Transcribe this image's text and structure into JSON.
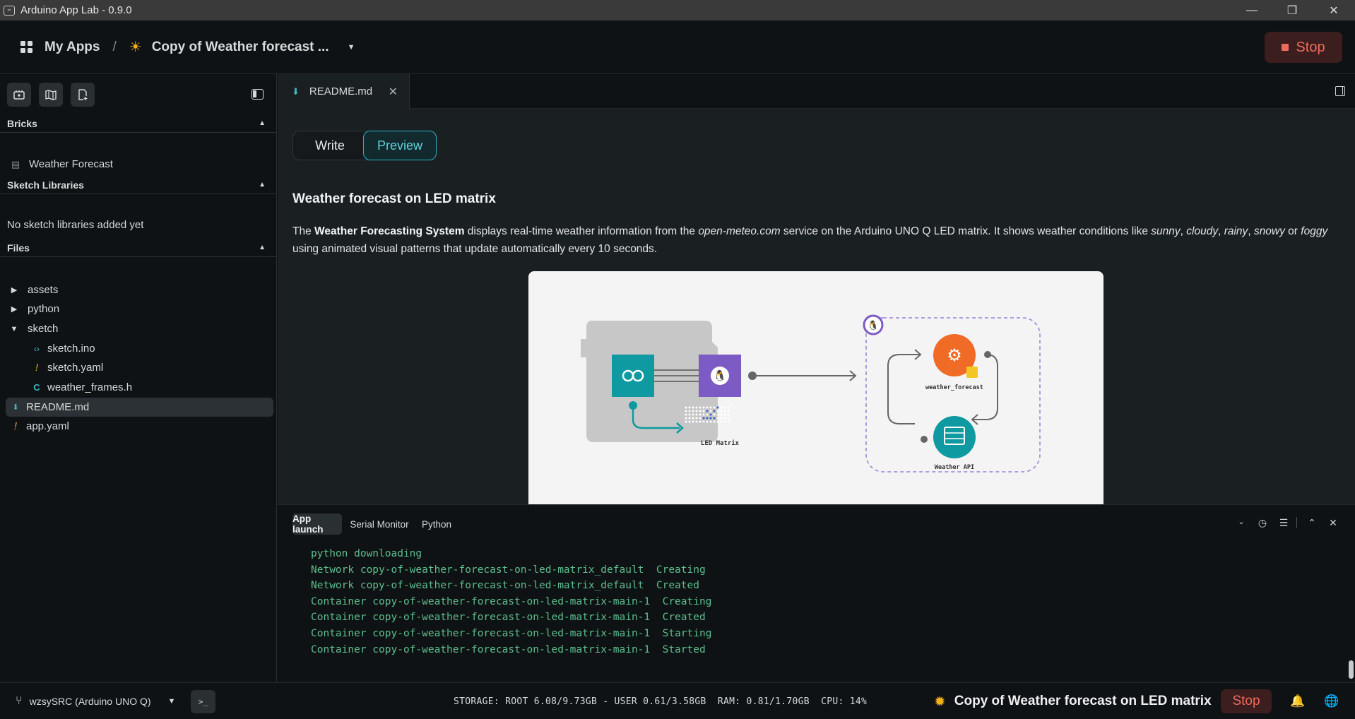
{
  "window": {
    "title": "Arduino App Lab - 0.9.0",
    "controls": {
      "minimize": "—",
      "restore": "❐",
      "close": "✕"
    }
  },
  "header": {
    "my_apps": "My Apps",
    "separator": "/",
    "app_name": "Copy of Weather forecast ...",
    "stop_label": "Stop"
  },
  "sidebar": {
    "bricks": {
      "heading": "Bricks",
      "items": [
        "Weather Forecast"
      ]
    },
    "sketch_libraries": {
      "heading": "Sketch Libraries",
      "empty": "No sketch libraries added yet"
    },
    "files": {
      "heading": "Files",
      "items": [
        {
          "name": "assets",
          "type": "folder",
          "expanded": false
        },
        {
          "name": "python",
          "type": "folder",
          "expanded": false
        },
        {
          "name": "sketch",
          "type": "folder",
          "expanded": true
        },
        {
          "name": "sketch.ino",
          "type": "ino"
        },
        {
          "name": "sketch.yaml",
          "type": "yaml"
        },
        {
          "name": "weather_frames.h",
          "type": "c-header"
        },
        {
          "name": "README.md",
          "type": "markdown",
          "selected": true
        },
        {
          "name": "app.yaml",
          "type": "yaml"
        }
      ]
    }
  },
  "editor": {
    "tab": {
      "label": "README.md"
    },
    "mode": {
      "write": "Write",
      "preview": "Preview",
      "active": "Preview"
    },
    "doc": {
      "title": "Weather forecast on LED matrix",
      "p_prefix": "The ",
      "p_bold": "Weather Forecasting System",
      "p_1": " displays real-time weather information from the ",
      "p_site": "open-meteo.com",
      "p_2": " service on the Arduino UNO Q LED matrix. It shows weather conditions like ",
      "p_sunny": "sunny",
      "p_comma1": ", ",
      "p_cloudy": "cloudy",
      "p_comma2": ", ",
      "p_rainy": "rainy",
      "p_comma3": ", ",
      "p_snowy": "snowy",
      "p_or": " or ",
      "p_foggy": "foggy",
      "p_end": " using animated visual patterns that update automatically every 10 seconds."
    },
    "diagram": {
      "led_label": "LED Matrix",
      "brick_label": "weather_forecast",
      "api_label": "Weather API"
    }
  },
  "console": {
    "tabs": [
      "App launch",
      "Serial Monitor",
      "Python"
    ],
    "active_tab": "App launch",
    "lines": [
      "python downloading",
      "Network copy-of-weather-forecast-on-led-matrix_default  Creating",
      "Network copy-of-weather-forecast-on-led-matrix_default  Created",
      "Container copy-of-weather-forecast-on-led-matrix-main-1  Creating",
      "Container copy-of-weather-forecast-on-led-matrix-main-1  Created",
      "Container copy-of-weather-forecast-on-led-matrix-main-1  Starting",
      "Container copy-of-weather-forecast-on-led-matrix-main-1  Started"
    ]
  },
  "statusbar": {
    "board": "wzsySRC (Arduino UNO Q)",
    "stats": "STORAGE: ROOT 6.08/9.73GB - USER 0.61/3.58GB  RAM: 0.81/1.70GB  CPU: 14%",
    "app_name": "Copy of Weather forecast on LED matrix",
    "stop_label": "Stop"
  },
  "colors": {
    "accent_teal": "#2bb3c0",
    "stop_red": "#ef6a5c",
    "log_green": "#5dbe8d",
    "sun_yellow": "#f3b21b"
  }
}
